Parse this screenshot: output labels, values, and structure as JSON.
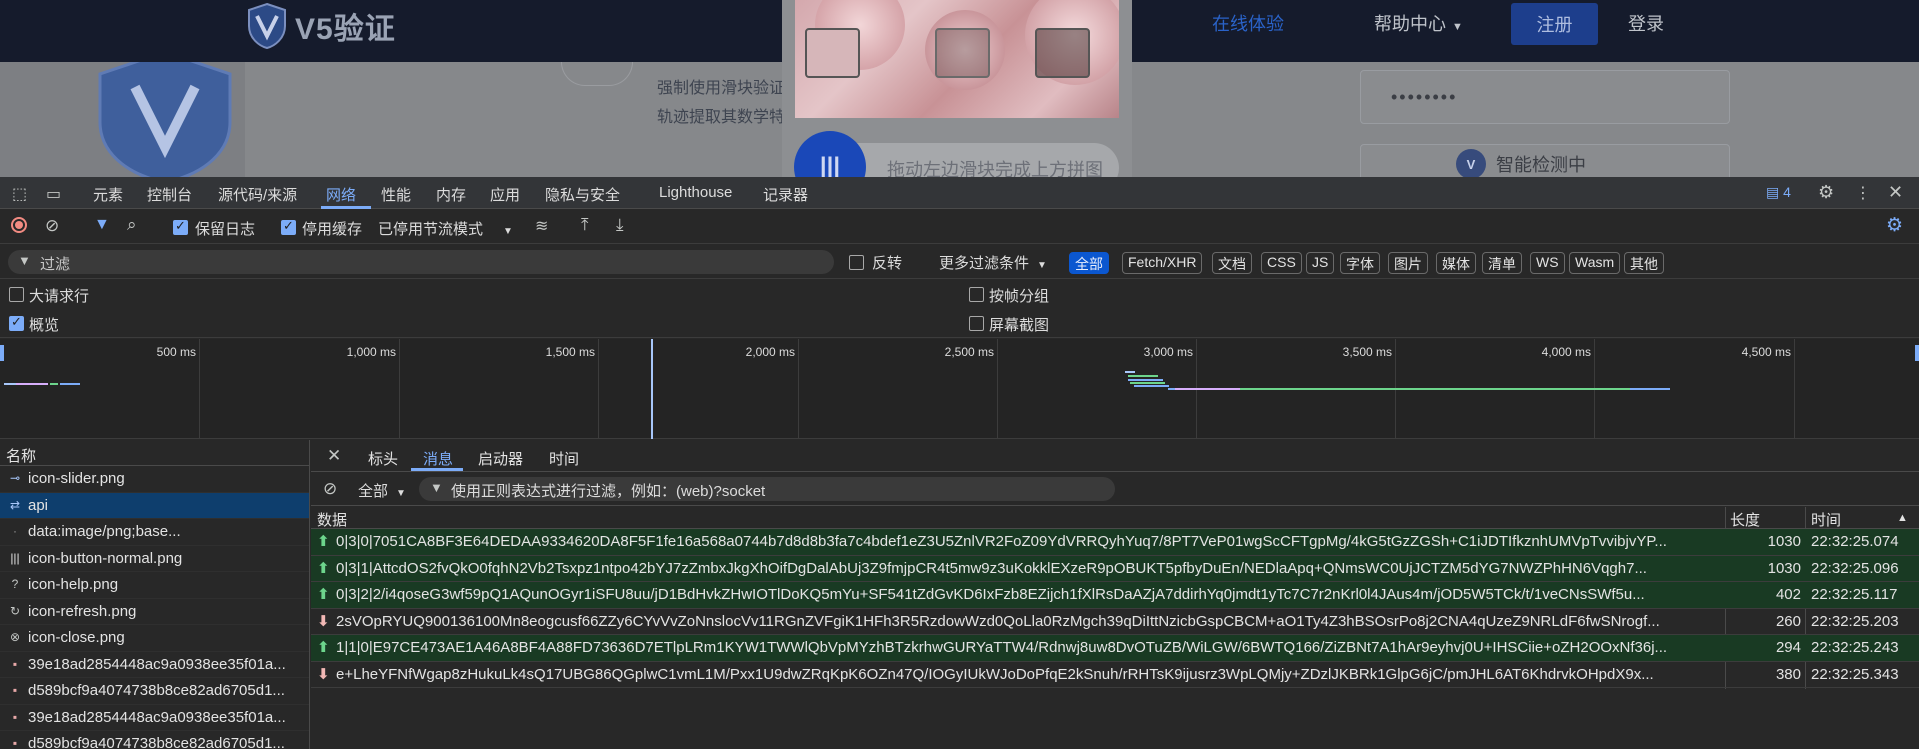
{
  "site": {
    "logo_text": "V5验证",
    "nav": {
      "online": "在线体验",
      "help": "帮助中心",
      "register": "注册",
      "login": "登录"
    },
    "description": "强制使用滑块验证，通过匿名收集用户行为数据户滑块轨迹提取其数学特征并提交到后台进行实定。",
    "password_mask": "••••••••",
    "smart_detect": "智能检测中",
    "captcha": {
      "slider_hint": "拖动左边滑块完成上方拼图"
    }
  },
  "devtools": {
    "tabs": [
      "元素",
      "控制台",
      "源代码/来源",
      "网络",
      "性能",
      "内存",
      "应用",
      "隐私与安全",
      "Lighthouse",
      "记录器"
    ],
    "active_tab": "网络",
    "issues_count": "4",
    "toolbar": {
      "preserve_log": "保留日志",
      "disable_cache": "停用缓存",
      "throttling": "已停用节流模式"
    },
    "filter": {
      "placeholder": "过滤",
      "invert": "反转",
      "more_filters": "更多过滤条件",
      "types": [
        "全部",
        "Fetch/XHR",
        "文档",
        "CSS",
        "JS",
        "字体",
        "图片",
        "媒体",
        "清单",
        "WS",
        "Wasm",
        "其他"
      ]
    },
    "options": {
      "big_rows": "大请求行",
      "overview": "概览",
      "group_by_frame": "按帧分组",
      "screenshots": "屏幕截图"
    },
    "overview_labels": [
      "500 ms",
      "1,000 ms",
      "1,500 ms",
      "2,000 ms",
      "2,500 ms",
      "3,000 ms",
      "3,500 ms",
      "4,000 ms",
      "4,500 ms"
    ],
    "requests": {
      "header": "名称",
      "items": [
        {
          "icon": "slider-icon",
          "name": "icon-slider.png"
        },
        {
          "icon": "websocket-icon",
          "name": "api"
        },
        {
          "icon": "dot-icon",
          "name": "data:image/png;base..."
        },
        {
          "icon": "bars-icon",
          "name": "icon-button-normal.png"
        },
        {
          "icon": "help-circle-icon",
          "name": "icon-help.png"
        },
        {
          "icon": "refresh-icon",
          "name": "icon-refresh.png"
        },
        {
          "icon": "close-circle-icon",
          "name": "icon-close.png"
        },
        {
          "icon": "image-icon",
          "name": "39e18ad2854448ac9a0938ee35f01a..."
        },
        {
          "icon": "image-icon",
          "name": "d589bcf9a4074738b8ce82ad6705d1..."
        },
        {
          "icon": "image-icon",
          "name": "39e18ad2854448ac9a0938ee35f01a..."
        },
        {
          "icon": "image-icon",
          "name": "d589bcf9a4074738b8ce82ad6705d1..."
        }
      ]
    },
    "detail": {
      "tabs": [
        "标头",
        "消息",
        "启动器",
        "时间"
      ],
      "active_tab": "消息",
      "message_filter_select": "全部",
      "message_filter_placeholder": "使用正则表达式进行过滤，例如：(web)?socket",
      "columns": {
        "data": "数据",
        "length": "长度",
        "time": "时间"
      },
      "messages": [
        {
          "dir": "sent",
          "data": "0|3|0|7051CA8BF3E64DEDAA9334620DA8F5F1fe16a568a0744b7d8d8b3fa7c4bdef1eZ3U5ZnlVR2FoZ09YdVRRQyhYuq7/8PT7VeP01wgScCFTgpMg/4kG5tGzZGSh+C1iJDTIfkznhUMVpTvvibjvYP...",
          "length": "1030",
          "time": "22:32:25.074"
        },
        {
          "dir": "sent",
          "data": "0|3|1|AttcdOS2fvQkO0fqhN2Vb2Tsxpz1ntpo42bYJ7zZmbxJkgXhOifDgDalAbUj3Z9fmjpCR4t5mw9z3uKokklEXzeR9pOBUKT5pfbyDuEn/NEDlaApq+QNmsWC0UjJCTZM5dYG7NWZPhHN6Vqgh7...",
          "length": "1030",
          "time": "22:32:25.096"
        },
        {
          "dir": "sent",
          "data": "0|3|2|2/i4qoseG3wf59pQ1AQunOGyr1iSFU8uu/jD1BdHvkZHwIOTlDoKQ5mYu+SF541tZdGvKD6IxFzb8EZijch1fXlRsDaAZjA7ddirhYq0jmdt1yTc7C7r2nKrl0l4JAus4m/jOD5W5TCk/t/1veCNsSWf5u...",
          "length": "402",
          "time": "22:32:25.117"
        },
        {
          "dir": "recv",
          "data": "2sVOpRYUQ900136100Mn8eogcusf66ZZy6CYvVvZoNnslocVv11RGnZVFgiK1HFh3R5RzdowWzd0QoLla0RzMgch39qDiIttNzicbGspCBCM+aO1Ty4Z3hBSOsrPo8j2CNA4qUzeZ9NRLdF6fwSNrogf...",
          "length": "260",
          "time": "22:32:25.203"
        },
        {
          "dir": "sent",
          "data": "1|1|0|E97CE473AE1A46A8BF4A88FD73636D7ETlpLRm1KYW1TWWlQbVpMYzhBTzkrhwGURYaTTW4/Rdnwj8uw8DvOTuZB/WiLGW/6BWTQ166/ZiZBNt7A1hAr9eyhvj0U+IHSCiie+oZH2OOxNf36j...",
          "length": "294",
          "time": "22:32:25.243"
        },
        {
          "dir": "recv",
          "data": "e+LheYFNfWgap8zHukuLk4sQ17UBG86QGplwC1vmL1M/Pxx1U9dwZRqKpK6OZn47Q/IOGyIUkWJoDoPfqE2kSnuh/rRHTsK9ijusrz3WpLQMjy+ZDzlJKBRk1GlpG6jC/pmJHL6AT6KhdrvkOHpdX9x...",
          "length": "380",
          "time": "22:32:25.343"
        }
      ]
    }
  }
}
